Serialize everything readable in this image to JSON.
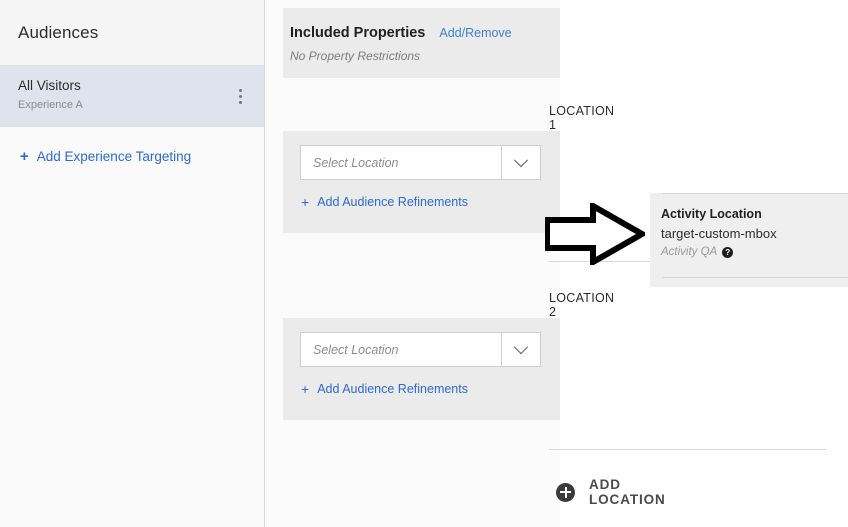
{
  "sidebar": {
    "header_title": "Audiences",
    "audience": {
      "name": "All Visitors",
      "experience": "Experience A",
      "menu_icon": "kebab-menu-icon"
    },
    "add_targeting": {
      "plus": "+",
      "label": "Add Experience Targeting"
    }
  },
  "properties_panel": {
    "included_properties": {
      "title": "Included Properties",
      "link": "Add/Remove",
      "subtitle": "No Property Restrictions"
    },
    "locations": [
      {
        "label": "LOCATION 1",
        "select_placeholder": "Select Location",
        "select_value": "",
        "dropdown_icon": "chevron-down-icon",
        "refine_plus": "+",
        "refine_label": "Add Audience Refinements"
      },
      {
        "label": "LOCATION 2",
        "select_placeholder": "Select Location",
        "select_value": "",
        "dropdown_icon": "chevron-down-icon",
        "refine_plus": "+",
        "refine_label": "Add Audience Refinements"
      }
    ],
    "add_location": {
      "icon": "circle-plus-icon",
      "label": "ADD LOCATION"
    }
  },
  "annotation": {
    "arrow_icon": "right-arrow-icon",
    "arrow_color": "#000000"
  },
  "activity_location": {
    "title": "Activity Location",
    "value": "target-custom-mbox",
    "qa_label": "Activity QA",
    "help_icon": "question-mark-icon",
    "help_glyph": "?"
  },
  "colors": {
    "link_blue": "#2b6bd4",
    "card_gray": "#ebebeb",
    "selected_row": "#dfe3ee",
    "panel_gray": "#efefef"
  }
}
